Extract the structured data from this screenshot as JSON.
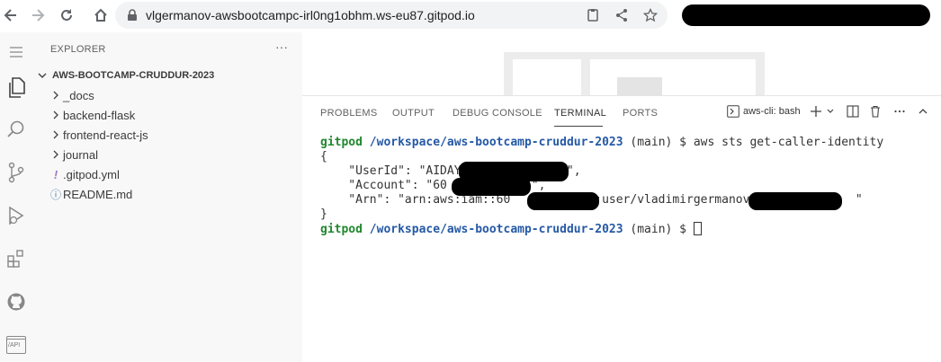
{
  "browser": {
    "url": "vlgermanov-awsbootcampc-irl0ng1obhm.ws-eu87.gitpod.io",
    "icons": [
      "back-arrow-icon",
      "forward-arrow-icon",
      "reload-icon",
      "lock-icon",
      "copy-icon",
      "share-icon",
      "star-icon"
    ]
  },
  "activity_bar": {
    "items": [
      "menu-icon",
      "files-icon",
      "search-icon",
      "source-control-icon",
      "run-debug-icon",
      "extensions-icon",
      "github-icon",
      "api-icon"
    ],
    "api_label": "/API"
  },
  "sidebar": {
    "title": "EXPLORER",
    "more": "···",
    "folder": "AWS-BOOTCAMP-CRUDDUR-2023",
    "items": [
      {
        "label": "_docs",
        "kind": "folder"
      },
      {
        "label": "backend-flask",
        "kind": "folder"
      },
      {
        "label": "frontend-react-js",
        "kind": "folder"
      },
      {
        "label": "journal",
        "kind": "folder"
      },
      {
        "label": ".gitpod.yml",
        "kind": "yaml",
        "glyph": "!"
      },
      {
        "label": "README.md",
        "kind": "info",
        "glyph": "ⓘ"
      }
    ]
  },
  "panel": {
    "tabs": [
      "PROBLEMS",
      "OUTPUT",
      "DEBUG CONSOLE",
      "TERMINAL",
      "PORTS"
    ],
    "active_tab": "TERMINAL",
    "terminal_name": "aws-cli: bash"
  },
  "terminal": {
    "prompt_user": "gitpod",
    "prompt_path": "/workspace/aws-bootcamp-cruddur-2023",
    "prompt_branch": " (main) $ ",
    "command": "aws sts get-caller-identity",
    "line_open": "{",
    "line_userid": "    \"UserId\": \"AIDAY              7\",",
    "line_account": "    \"Account\": \"60          94\",",
    "line_arn": "    \"Arn\": \"arn:aws:iam::60          94:user/vladimirgermanov_              \"",
    "line_close": "}"
  },
  "colors": {
    "accent_green": "#21872f",
    "accent_blue": "#2559a6"
  }
}
